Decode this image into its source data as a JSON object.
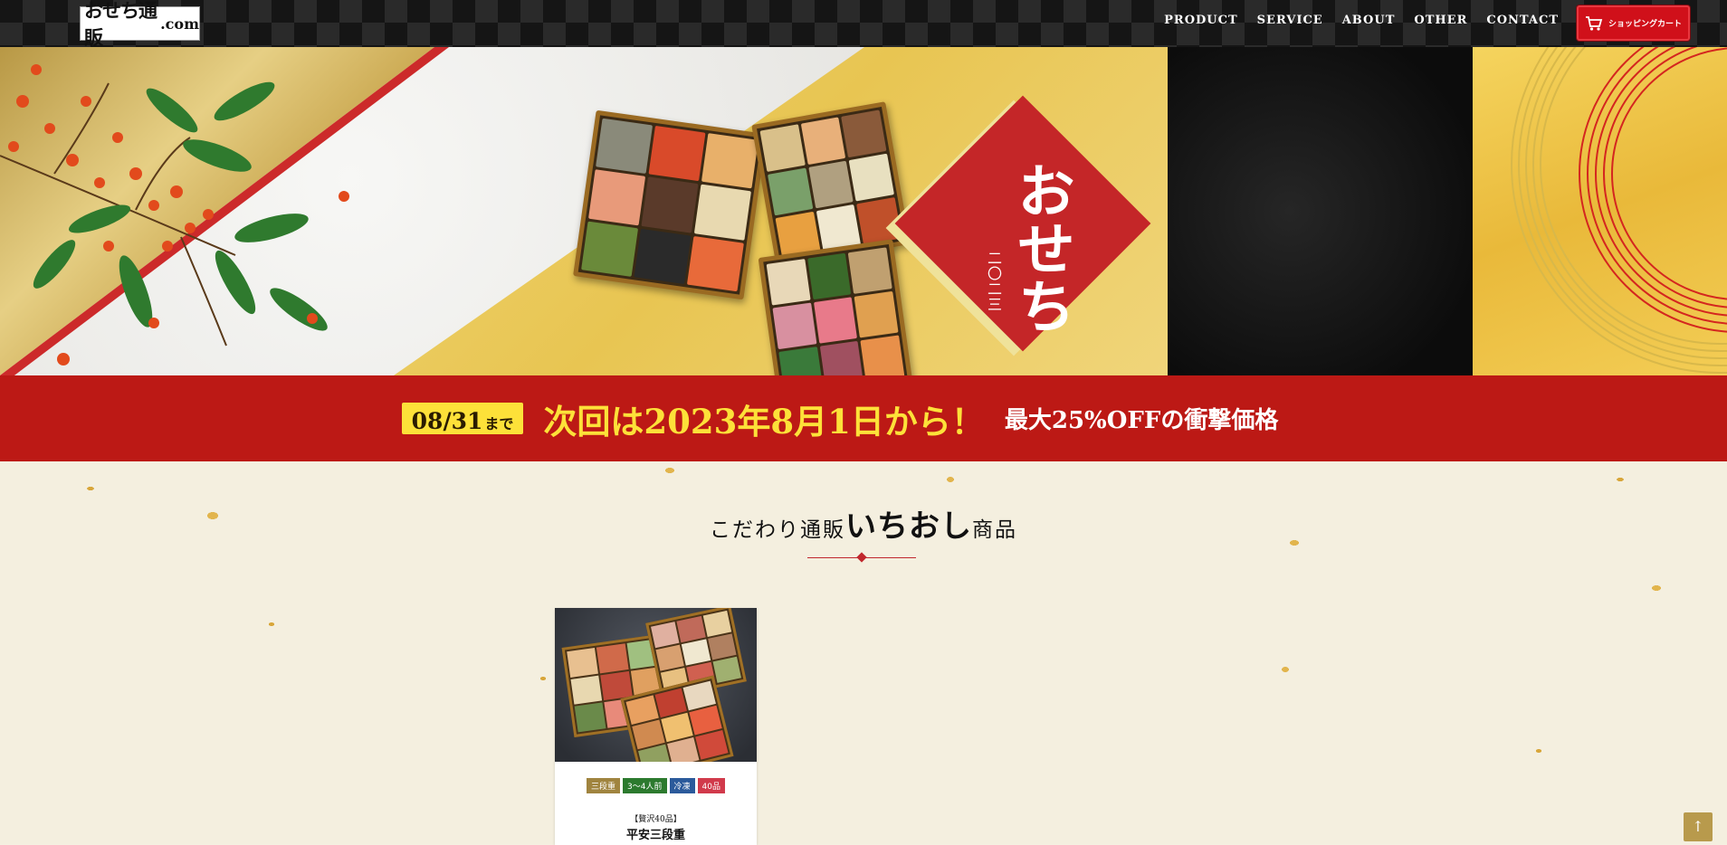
{
  "header": {
    "logo_main": "おせち通販",
    "logo_domain": ".com",
    "nav": [
      "PRODUCT",
      "SERVICE",
      "ABOUT",
      "OTHER",
      "CONTACT"
    ],
    "cart_label": "ショッピングカート"
  },
  "hero": {
    "title": "おせち",
    "year": "二〇二三"
  },
  "promo": {
    "date": "08/31",
    "date_suffix": "まで",
    "next_sale": "次回は2023年8月1日から！",
    "discount": "最大25%OFFの衝撃価格"
  },
  "section": {
    "title_prefix": "こだわり通販",
    "title_main": "いちおし",
    "title_suffix": "商品"
  },
  "product": {
    "tags": [
      {
        "label": "三段重",
        "color": "#a0843f"
      },
      {
        "label": "3〜4人前",
        "color": "#2c7a2e"
      },
      {
        "label": "冷凍",
        "color": "#2b5a9b"
      },
      {
        "label": "40品",
        "color": "#d13a4b"
      }
    ],
    "subtitle": "【贅沢40品】",
    "name": "平安三段重"
  },
  "colors": {
    "header_bg": "#151515",
    "promo_bg": "#bc1915",
    "promo_accent": "#fde139",
    "cart_bg": "#d0101a",
    "content_bg": "#f4efdf"
  },
  "icons": {
    "cart": "cart-icon",
    "back_to_top": "arrow-up-icon"
  }
}
